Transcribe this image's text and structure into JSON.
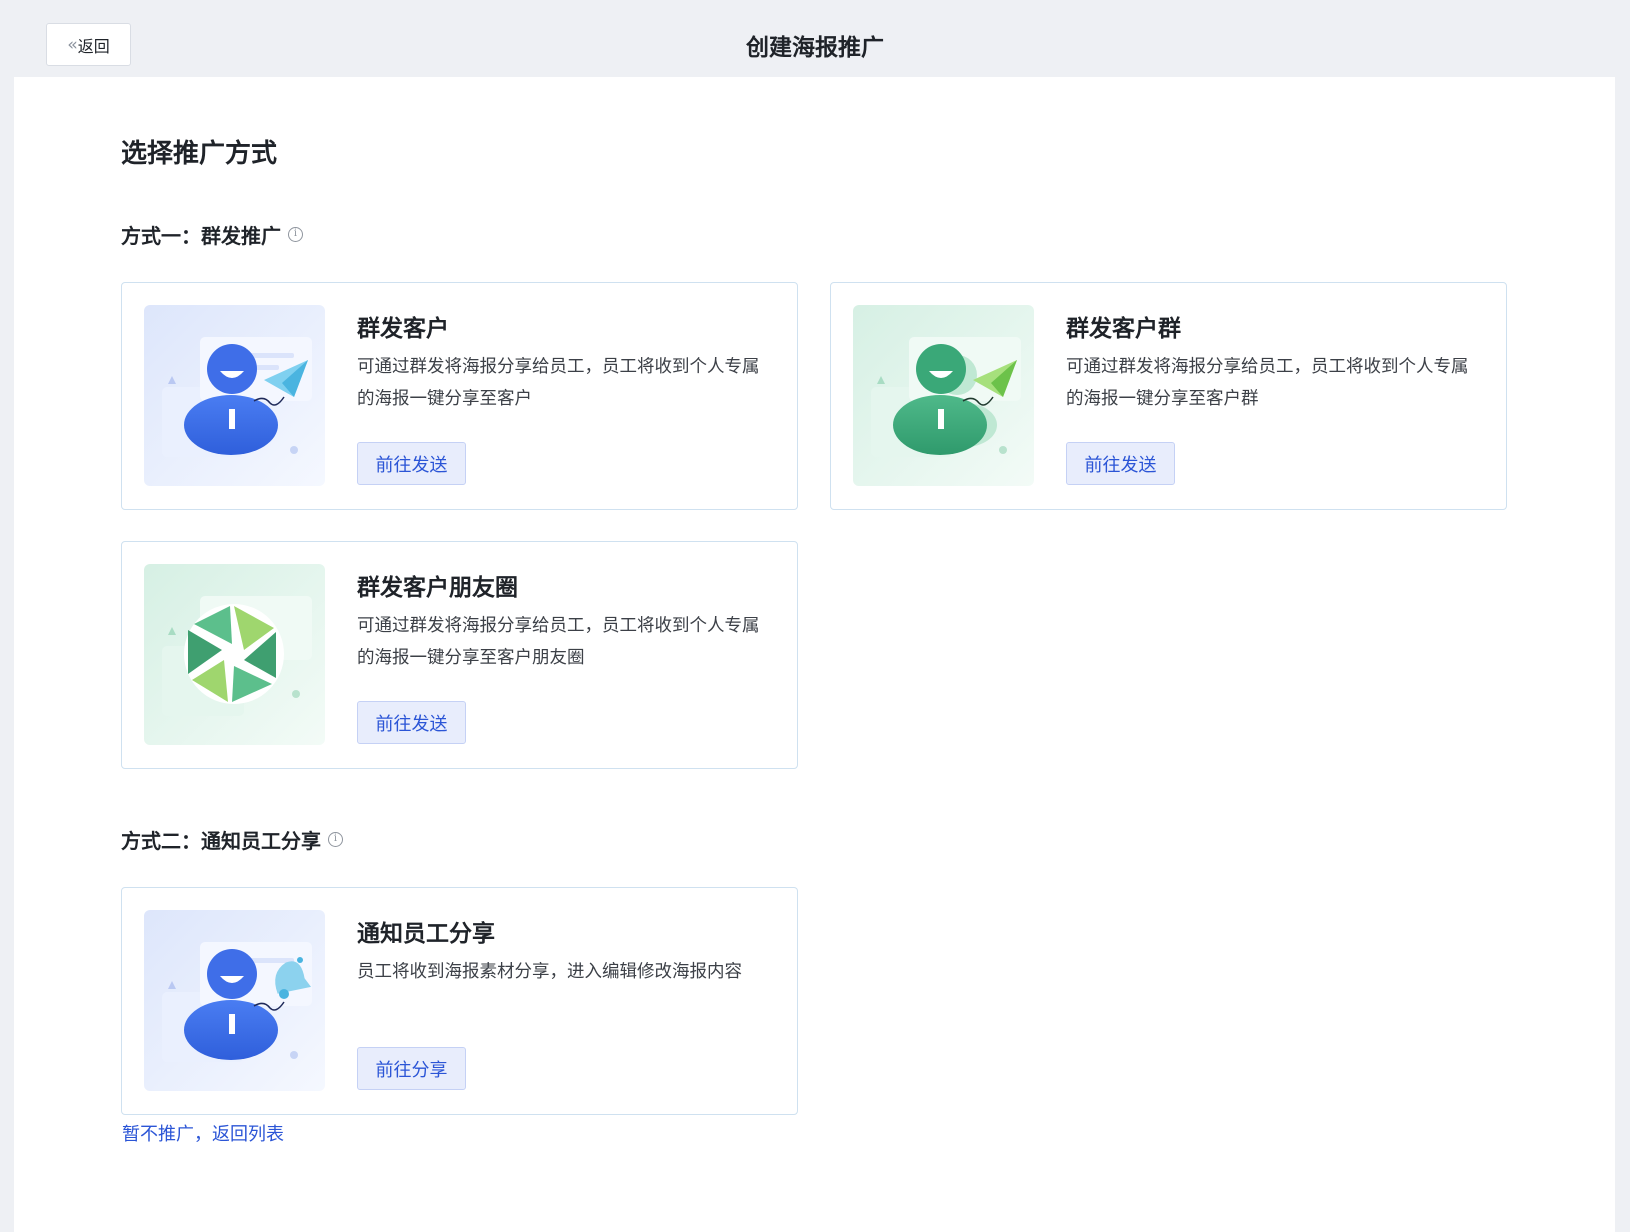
{
  "header": {
    "back_label": "返回",
    "title": "创建海报推广"
  },
  "main": {
    "section_title": "选择推广方式",
    "methods": [
      {
        "title": "方式一：群发推广",
        "cards": [
          {
            "title": "群发客户",
            "desc": "可通过群发将海报分享给员工，员工将收到个人专属的海报一键分享至客户",
            "button": "前往发送",
            "illustration": "person-paper-plane-blue"
          },
          {
            "title": "群发客户群",
            "desc": "可通过群发将海报分享给员工，员工将收到个人专属的海报一键分享至客户群",
            "button": "前往发送",
            "illustration": "person-group-paper-plane-green"
          },
          {
            "title": "群发客户朋友圈",
            "desc": "可通过群发将海报分享给员工，员工将收到个人专属的海报一键分享至客户朋友圈",
            "button": "前往发送",
            "illustration": "moments-aperture-green"
          }
        ]
      },
      {
        "title": "方式二：通知员工分享",
        "cards": [
          {
            "title": "通知员工分享",
            "desc": "员工将收到海报素材分享，进入编辑修改海报内容",
            "button": "前往分享",
            "illustration": "person-bell-blue"
          }
        ]
      }
    ],
    "footer_link": "暂不推广，返回列表"
  },
  "colors": {
    "accent": "#2b55d6",
    "button_bg": "#e8edfc",
    "card_border": "#cfe1f0",
    "page_bg": "#eef0f4"
  }
}
